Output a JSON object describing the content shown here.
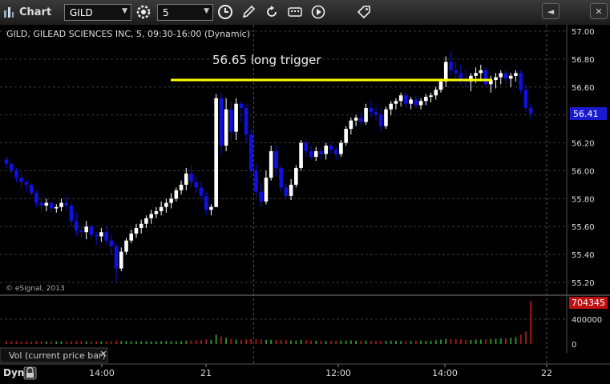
{
  "toolbar": {
    "app_label": "Chart",
    "symbol": "GILD",
    "interval": "5",
    "icons": [
      "chart-icon",
      "symbol-dropdown-icon",
      "settings-icon",
      "interval-dropdown-icon",
      "clock-icon",
      "pencil-icon",
      "refresh-icon",
      "keyboard-icon",
      "play-icon",
      "tag-icon",
      "window-left-icon",
      "window-close-icon"
    ]
  },
  "chart_header": "GILD, GILEAD SCIENCES INC, 5, 09:30-16:00 (Dynamic)",
  "annotation": {
    "text": "56.65 long trigger",
    "price": 56.65,
    "color": "#ffff00"
  },
  "last_price_label": "56.41",
  "copyright": "© eSignal, 2013",
  "volume_label": "Vol (current price bar)",
  "volume_close": "×",
  "volume_last_label": "704345",
  "volume_ticks": [
    "400000",
    "0"
  ],
  "bottom": {
    "dyn_label": "Dyn"
  },
  "colors": {
    "up": "#ffffff",
    "down": "#1010e0",
    "vol_up": "#2e8b2e",
    "vol_down": "#a01818",
    "grid": "#3a3a3a",
    "price_badge": "#1a1ad0",
    "vol_badge": "#c01010"
  },
  "chart_data": {
    "type": "candlestick",
    "symbol": "GILD",
    "interval_minutes": 5,
    "y_ticks": [
      "57.00",
      "56.80",
      "56.60",
      "56.40",
      "56.20",
      "56.00",
      "55.80",
      "55.60",
      "55.40",
      "55.20"
    ],
    "x_tick_labels": [
      "14:00",
      "21",
      "12:00",
      "14:00",
      "22"
    ],
    "ylim": [
      55.15,
      57.03
    ],
    "session_breaks": [
      50,
      133
    ],
    "horizontal_line": 56.65,
    "candles_ohlc": [
      [
        56.08,
        56.1,
        56.02,
        56.05
      ],
      [
        56.05,
        56.06,
        55.98,
        56.0
      ],
      [
        56.0,
        56.02,
        55.92,
        55.95
      ],
      [
        55.95,
        55.98,
        55.88,
        55.92
      ],
      [
        55.92,
        55.94,
        55.85,
        55.9
      ],
      [
        55.9,
        55.91,
        55.82,
        55.84
      ],
      [
        55.84,
        55.86,
        55.74,
        55.77
      ],
      [
        55.77,
        55.8,
        55.7,
        55.75
      ],
      [
        55.75,
        55.8,
        55.71,
        55.77
      ],
      [
        55.77,
        55.78,
        55.7,
        55.73
      ],
      [
        55.73,
        55.76,
        55.7,
        55.74
      ],
      [
        55.74,
        55.8,
        55.71,
        55.77
      ],
      [
        55.77,
        55.82,
        55.72,
        55.75
      ],
      [
        55.75,
        55.77,
        55.6,
        55.64
      ],
      [
        55.64,
        55.7,
        55.53,
        55.57
      ],
      [
        55.57,
        55.6,
        55.52,
        55.56
      ],
      [
        55.56,
        55.64,
        55.51,
        55.6
      ],
      [
        55.6,
        55.62,
        55.51,
        55.54
      ],
      [
        55.54,
        55.56,
        55.47,
        55.53
      ],
      [
        55.53,
        55.59,
        55.49,
        55.56
      ],
      [
        55.56,
        55.6,
        55.47,
        55.5
      ],
      [
        55.5,
        55.55,
        55.4,
        55.46
      ],
      [
        55.46,
        55.48,
        55.2,
        55.3
      ],
      [
        55.3,
        55.45,
        55.28,
        55.42
      ],
      [
        55.42,
        55.52,
        55.4,
        55.5
      ],
      [
        55.5,
        55.58,
        55.48,
        55.55
      ],
      [
        55.55,
        55.62,
        55.52,
        55.59
      ],
      [
        55.59,
        55.65,
        55.55,
        55.62
      ],
      [
        55.62,
        55.68,
        55.59,
        55.66
      ],
      [
        55.66,
        55.72,
        55.62,
        55.69
      ],
      [
        55.69,
        55.74,
        55.66,
        55.71
      ],
      [
        55.71,
        55.78,
        55.68,
        55.74
      ],
      [
        55.74,
        55.8,
        55.7,
        55.77
      ],
      [
        55.77,
        55.84,
        55.73,
        55.8
      ],
      [
        55.8,
        55.88,
        55.78,
        55.86
      ],
      [
        55.86,
        55.93,
        55.83,
        55.9
      ],
      [
        55.9,
        56.02,
        55.86,
        55.98
      ],
      [
        55.98,
        56.04,
        55.88,
        55.92
      ],
      [
        55.92,
        55.96,
        55.84,
        55.88
      ],
      [
        55.88,
        55.92,
        55.78,
        55.82
      ],
      [
        55.82,
        55.85,
        55.68,
        55.72
      ],
      [
        55.72,
        55.76,
        55.68,
        55.74
      ],
      [
        55.74,
        56.55,
        55.74,
        56.52
      ],
      [
        56.52,
        56.55,
        56.12,
        56.18
      ],
      [
        56.18,
        56.52,
        56.14,
        56.44
      ],
      [
        56.44,
        56.5,
        56.22,
        56.28
      ],
      [
        56.28,
        56.52,
        56.22,
        56.48
      ],
      [
        56.48,
        56.5,
        56.35,
        56.45
      ],
      [
        56.45,
        56.48,
        56.2,
        56.26
      ],
      [
        56.26,
        56.3,
        55.95,
        56.0
      ],
      [
        56.0,
        56.05,
        55.82,
        55.85
      ],
      [
        55.85,
        55.92,
        55.74,
        55.78
      ],
      [
        55.78,
        56.0,
        55.76,
        55.95
      ],
      [
        55.95,
        56.18,
        55.93,
        56.14
      ],
      [
        56.14,
        56.18,
        55.96,
        56.02
      ],
      [
        56.02,
        56.04,
        55.85,
        55.88
      ],
      [
        55.88,
        55.91,
        55.8,
        55.82
      ],
      [
        55.82,
        55.94,
        55.79,
        55.9
      ],
      [
        55.9,
        56.04,
        55.88,
        56.02
      ],
      [
        56.02,
        56.22,
        56.0,
        56.2
      ],
      [
        56.2,
        56.23,
        56.1,
        56.14
      ],
      [
        56.14,
        56.18,
        56.08,
        56.1
      ],
      [
        56.1,
        56.17,
        56.07,
        56.14
      ],
      [
        56.14,
        56.16,
        56.08,
        56.12
      ],
      [
        56.12,
        56.2,
        56.08,
        56.18
      ],
      [
        56.18,
        56.2,
        56.12,
        56.15
      ],
      [
        56.15,
        56.18,
        56.08,
        56.12
      ],
      [
        56.12,
        56.22,
        56.1,
        56.2
      ],
      [
        56.2,
        56.32,
        56.18,
        56.3
      ],
      [
        56.3,
        56.38,
        56.26,
        56.36
      ],
      [
        56.36,
        56.4,
        56.32,
        56.38
      ],
      [
        56.38,
        56.42,
        56.32,
        56.35
      ],
      [
        56.35,
        56.48,
        56.33,
        56.45
      ],
      [
        56.45,
        56.5,
        56.38,
        56.42
      ],
      [
        56.42,
        56.46,
        56.36,
        56.4
      ],
      [
        56.4,
        56.45,
        56.28,
        56.32
      ],
      [
        56.32,
        56.46,
        56.3,
        56.44
      ],
      [
        56.44,
        56.5,
        56.4,
        56.48
      ],
      [
        56.48,
        56.52,
        56.44,
        56.5
      ],
      [
        56.5,
        56.56,
        56.46,
        56.54
      ],
      [
        56.54,
        56.56,
        56.45,
        56.48
      ],
      [
        56.48,
        56.53,
        56.44,
        56.51
      ],
      [
        56.51,
        56.54,
        56.45,
        56.47
      ],
      [
        56.47,
        56.52,
        56.44,
        56.5
      ],
      [
        56.5,
        56.55,
        56.47,
        56.53
      ],
      [
        56.53,
        56.56,
        56.49,
        56.54
      ],
      [
        56.54,
        56.6,
        56.51,
        56.58
      ],
      [
        56.58,
        56.66,
        56.56,
        56.64
      ],
      [
        56.64,
        56.82,
        56.6,
        56.78
      ],
      [
        56.78,
        56.86,
        56.68,
        56.72
      ],
      [
        56.72,
        56.78,
        56.64,
        56.7
      ],
      [
        56.7,
        56.76,
        56.62,
        56.66
      ],
      [
        56.66,
        56.72,
        56.6,
        56.64
      ],
      [
        56.64,
        56.7,
        56.57,
        56.68
      ],
      [
        56.68,
        56.74,
        56.63,
        56.7
      ],
      [
        56.7,
        56.76,
        56.64,
        56.72
      ],
      [
        56.72,
        56.74,
        56.6,
        56.62
      ],
      [
        56.62,
        56.68,
        56.56,
        56.65
      ],
      [
        56.65,
        56.7,
        56.59,
        56.67
      ],
      [
        56.67,
        56.72,
        56.62,
        56.7
      ],
      [
        56.7,
        56.72,
        56.62,
        56.66
      ],
      [
        56.66,
        56.7,
        56.6,
        56.68
      ],
      [
        56.68,
        56.72,
        56.64,
        56.7
      ],
      [
        56.7,
        56.72,
        56.55,
        56.58
      ],
      [
        56.58,
        56.62,
        56.42,
        56.45
      ],
      [
        56.45,
        56.48,
        56.38,
        56.41
      ]
    ],
    "volume": [
      50000,
      45000,
      48000,
      40000,
      42000,
      38000,
      47000,
      44000,
      39000,
      41000,
      43000,
      45000,
      40000,
      42000,
      46000,
      48000,
      44000,
      42000,
      40000,
      43000,
      45000,
      47000,
      52000,
      49000,
      46000,
      44000,
      42000,
      45000,
      47000,
      43000,
      41000,
      45000,
      48000,
      46000,
      44000,
      47000,
      52000,
      55000,
      58000,
      62000,
      75000,
      68000,
      150000,
      120000,
      100000,
      80000,
      70000,
      65000,
      75000,
      80000,
      78000,
      72000,
      70000,
      68000,
      65000,
      62000,
      60000,
      58000,
      55000,
      65000,
      60000,
      55000,
      52000,
      50000,
      48000,
      50000,
      52000,
      54000,
      55000,
      57000,
      53000,
      51000,
      56000,
      52000,
      50000,
      49000,
      51000,
      53000,
      50000,
      48000,
      46000,
      48000,
      52000,
      55000,
      50000,
      52000,
      60000,
      70000,
      85000,
      80000,
      75000,
      72000,
      68000,
      65000,
      70000,
      72000,
      75000,
      80000,
      85000,
      90000,
      95000,
      100000,
      110000,
      150000,
      200000,
      704345
    ]
  }
}
